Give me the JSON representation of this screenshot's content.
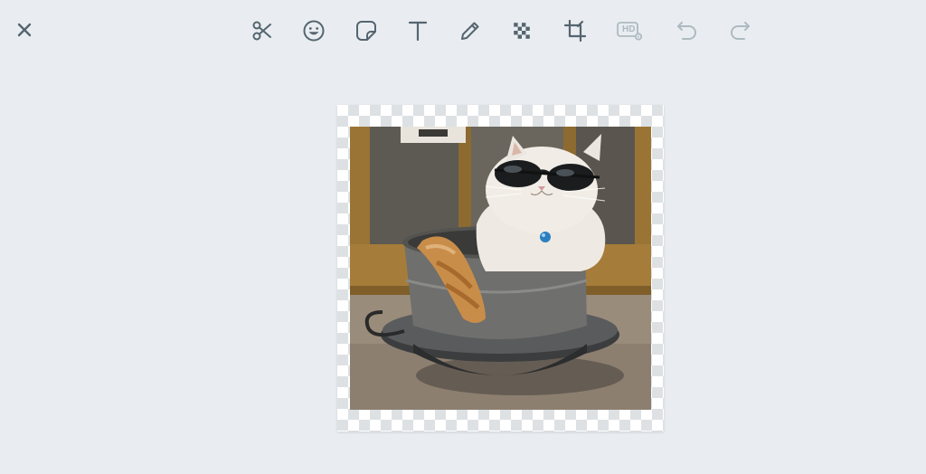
{
  "editor": {
    "close_label": "Close",
    "tools": [
      {
        "icon": "scissors-icon",
        "name": "cut"
      },
      {
        "icon": "emoji-icon",
        "name": "emoji"
      },
      {
        "icon": "sticker-icon",
        "name": "sticker"
      },
      {
        "icon": "text-icon",
        "name": "text"
      },
      {
        "icon": "pencil-icon",
        "name": "draw"
      },
      {
        "icon": "blur-icon",
        "name": "blur"
      },
      {
        "icon": "crop-icon",
        "name": "crop"
      },
      {
        "icon": "hd-settings-icon",
        "name": "hd",
        "label": "HD",
        "enabled": false
      },
      {
        "icon": "undo-icon",
        "name": "undo",
        "enabled": false
      },
      {
        "icon": "redo-icon",
        "name": "redo",
        "enabled": false
      }
    ],
    "colors": {
      "background": "#e9edf1",
      "icon_active": "#54656f",
      "icon_disabled": "#aebac1"
    }
  },
  "image": {
    "subject": "cat-in-pot-with-sunglasses"
  }
}
